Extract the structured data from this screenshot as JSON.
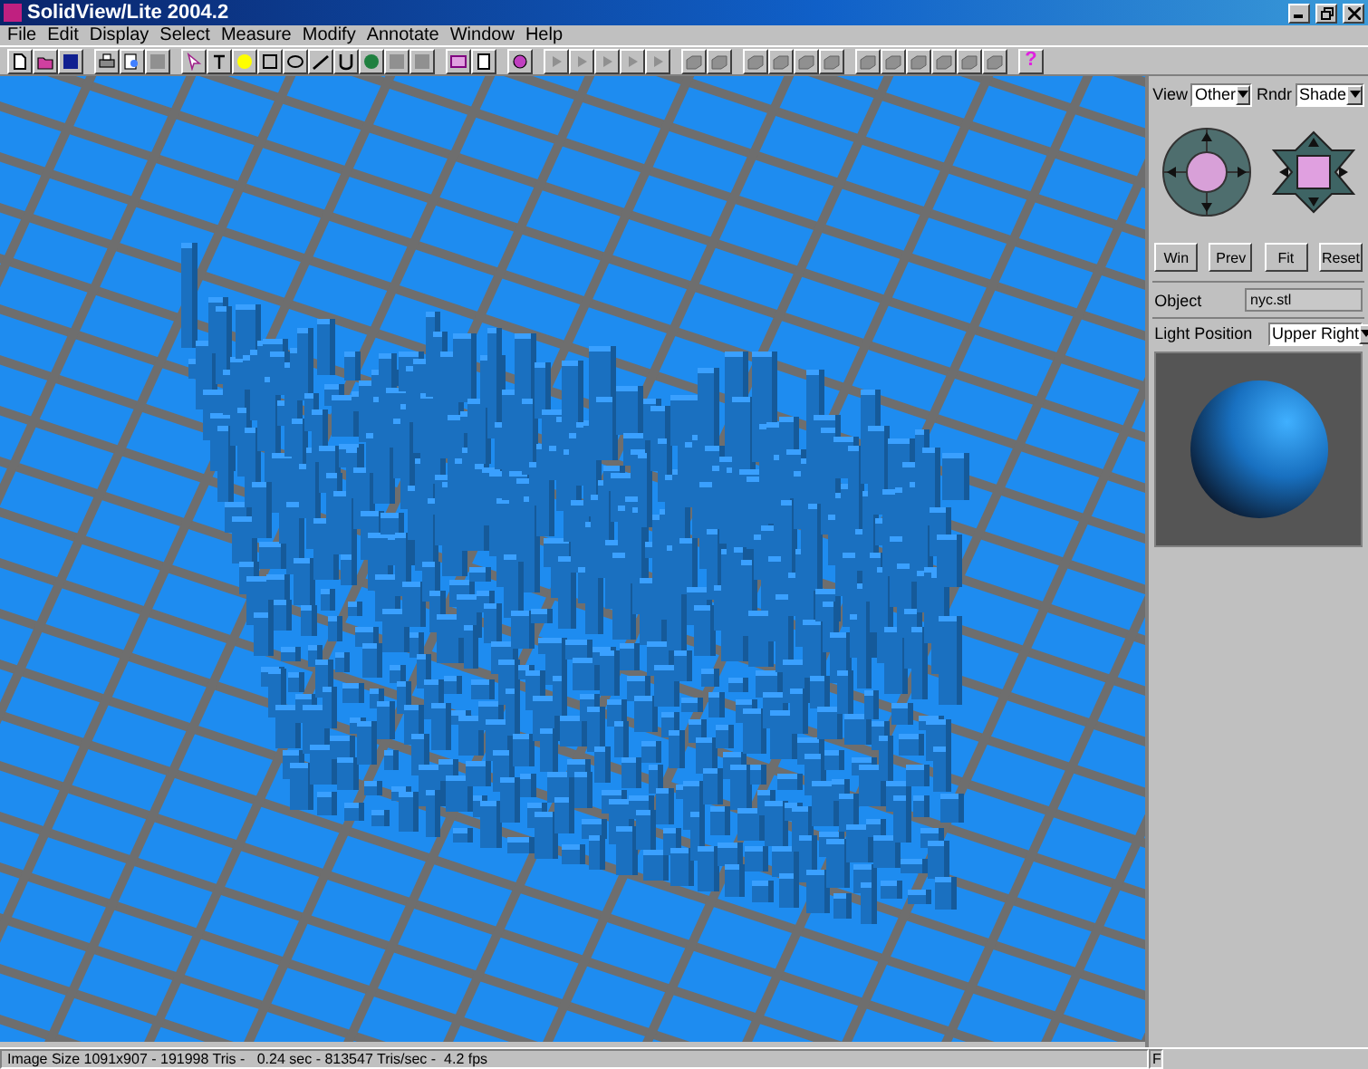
{
  "window": {
    "title": "SolidView/Lite 2004.2"
  },
  "menu": [
    "File",
    "Edit",
    "Display",
    "Select",
    "Measure",
    "Modify",
    "Annotate",
    "Window",
    "Help"
  ],
  "help_button": "?",
  "side_panel": {
    "view": {
      "label": "View",
      "value": "Other"
    },
    "render": {
      "label": "Rndr",
      "value": "Shade"
    },
    "buttons": [
      "Win",
      "Prev",
      "Fit",
      "Reset"
    ],
    "object": {
      "label": "Object",
      "value": "nyc.stl"
    },
    "light_position": {
      "label": "Light Position",
      "value": "Upper Right"
    }
  },
  "status_bar": {
    "text": "Image Size 1091x907 - 191998 Tris -   0.24 sec - 813547 Tris/sec -  4.2 fps",
    "indicator": "F"
  }
}
